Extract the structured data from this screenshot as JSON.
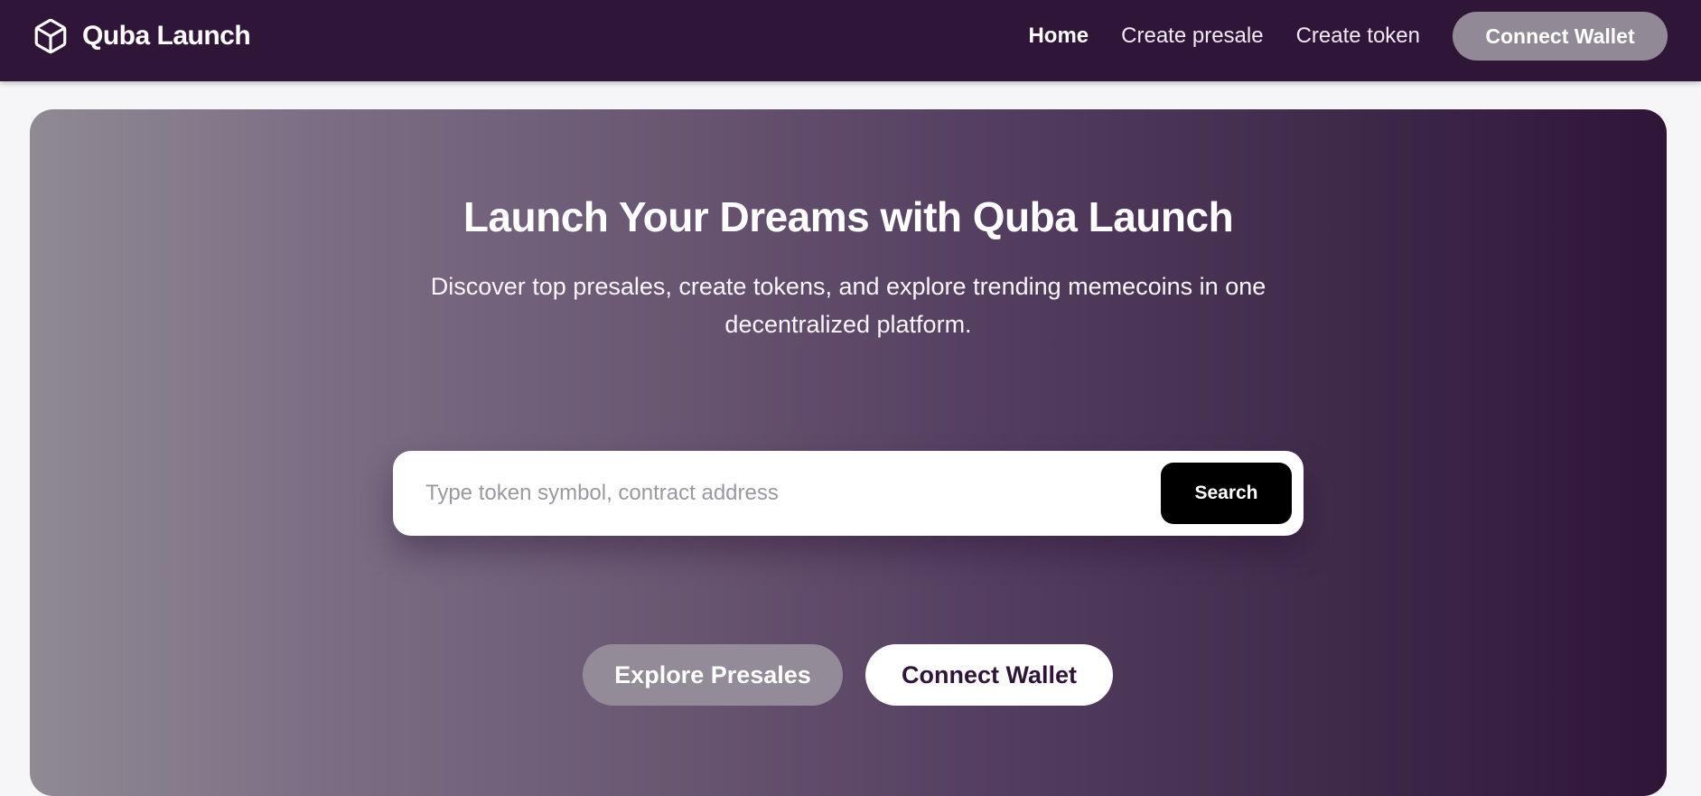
{
  "brand": {
    "name": "Quba Launch",
    "icon": "cube-icon"
  },
  "nav": {
    "links": [
      {
        "label": "Home",
        "active": true
      },
      {
        "label": "Create presale",
        "active": false
      },
      {
        "label": "Create token",
        "active": false
      }
    ],
    "wallet_label": "Connect Wallet"
  },
  "hero": {
    "title": "Launch Your Dreams with Quba Launch",
    "subtitle": "Discover top presales, create tokens, and explore trending memecoins in one decentralized platform.",
    "search": {
      "placeholder": "Type token symbol, contract address",
      "value": "",
      "button_label": "Search"
    },
    "explore_label": "Explore Presales",
    "connect_label": "Connect Wallet"
  },
  "colors": {
    "navbar_bg": "#2f1538",
    "hero_gradient_start": "#8f8a93",
    "hero_gradient_end": "#2f1538",
    "accent_button": "#938b98",
    "search_button": "#000000"
  }
}
